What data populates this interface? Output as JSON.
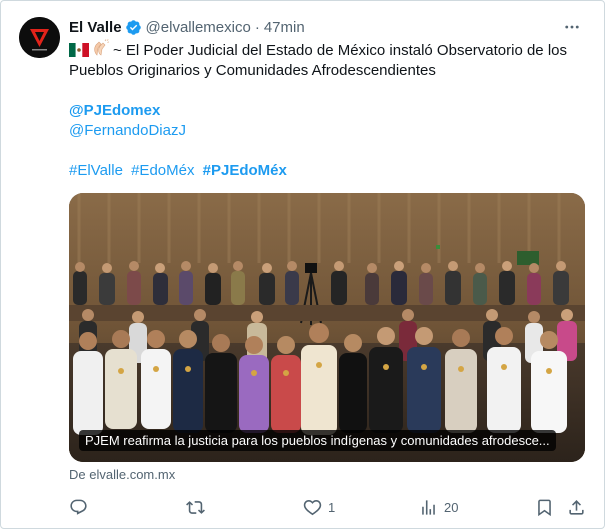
{
  "tweet": {
    "author_name": "El Valle",
    "author_handle": "@elvallemexico",
    "separator": "·",
    "time": "47min",
    "text_line1": "~ El Poder Judicial del Estado de México instaló Observatorio de los",
    "text_line2": "Pueblos Originarios y Comunidades Afrodescendientes",
    "mention1": "@PJEdomex",
    "mention2": "@FernandoDiazJ",
    "hashtags": [
      "#ElValle",
      "#EdoMéx",
      "#PJEdoMéx"
    ],
    "media_caption": "PJEM reafirma la justicia para los pueblos indígenas y comunidades afrodesce...",
    "source": "De elvalle.com.mx"
  },
  "actions": {
    "reply_count": "",
    "retweet_count": "",
    "like_count": "1",
    "views_count": "20"
  },
  "colors": {
    "accent": "#1d9bf0",
    "secondary_text": "#536471",
    "avatar_bg": "#0d0d0d",
    "logo_red": "#e2231a"
  },
  "icons": [
    "verified-badge-icon",
    "more-icon",
    "mexico-flag-icon",
    "clapping-hands-icon",
    "reply-icon",
    "retweet-icon",
    "like-icon",
    "views-icon",
    "bookmark-icon",
    "share-icon"
  ]
}
